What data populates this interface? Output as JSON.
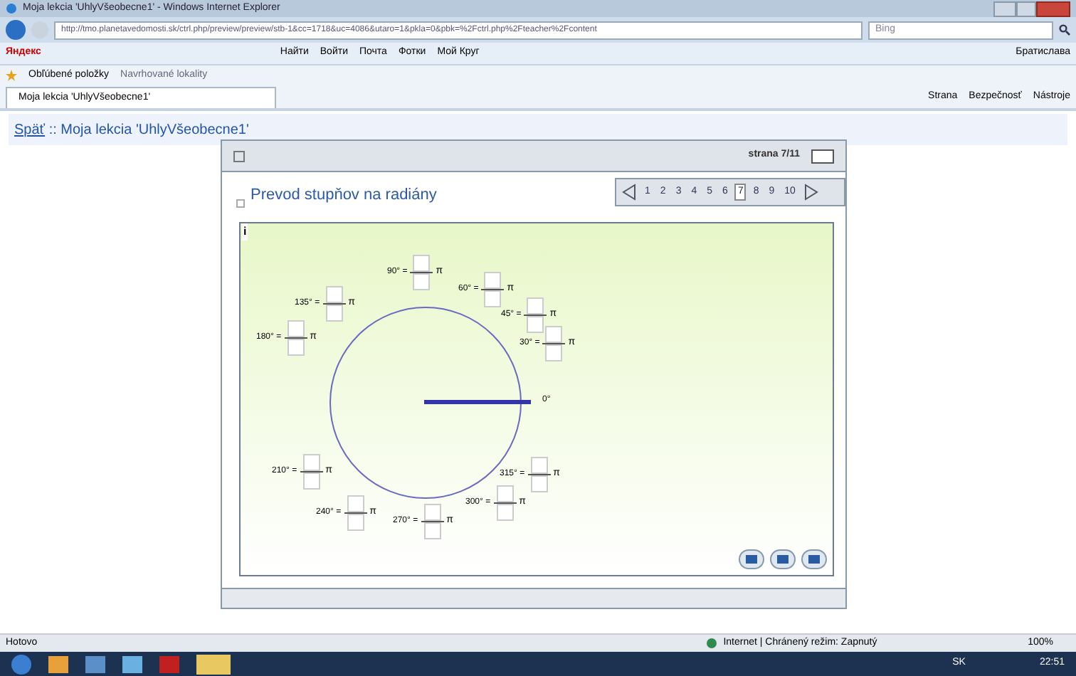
{
  "window": {
    "title": "Moja lekcia 'UhlyVšeobecne1' - Windows Internet Explorer"
  },
  "address_bar": {
    "url": "http://tmo.planetavedomosti.sk/ctrl.php/preview/preview/stb-1&cc=1718&uc=4086&utaro=1&pkla=0&pbk=%2Fctrl.php%2Fteacher%2Fcontent",
    "search_placeholder": "Bing"
  },
  "yandex_toolbar": {
    "logo": "Яндекс",
    "search_button": "Найти",
    "items": [
      "Войти",
      "Почта",
      "Фотки",
      "Мой Круг"
    ],
    "city": "Братислава"
  },
  "favorites_bar": {
    "favorites": "Obľúbené položky",
    "suggested": "Navrhované lokality"
  },
  "tabs": [
    {
      "label": "Moja lekcia 'UhlyVšeobecne1'",
      "selected": true
    }
  ],
  "command_bar": [
    "Strana",
    "Bezpečnosť",
    "Nástroje"
  ],
  "page": {
    "back_link": "Späť",
    "breadcrumb": " :: Moja lekcia 'UhlyVšeobecne1'",
    "lesson": {
      "page_indicator": "strana 7/11",
      "title": "Prevod stupňov na radiány",
      "info": "i",
      "pages": [
        {
          "label": "1",
          "selected": false
        },
        {
          "label": "2",
          "selected": false
        },
        {
          "label": "3",
          "selected": false
        },
        {
          "label": "4",
          "selected": false
        },
        {
          "label": "5",
          "selected": false
        },
        {
          "label": "6",
          "selected": false
        },
        {
          "label": "7",
          "selected": true
        },
        {
          "label": "8",
          "selected": false
        },
        {
          "label": "9",
          "selected": false
        },
        {
          "label": "10",
          "selected": false
        }
      ],
      "zero_label": "0°",
      "angles": [
        {
          "label": "90° =",
          "pi": "π"
        },
        {
          "label": "60° =",
          "pi": "π"
        },
        {
          "label": "135° =",
          "pi": "π"
        },
        {
          "label": "45° =",
          "pi": "π"
        },
        {
          "label": "180° =",
          "pi": "π"
        },
        {
          "label": "30° =",
          "pi": "π"
        },
        {
          "label": "210° =",
          "pi": "π"
        },
        {
          "label": "315° =",
          "pi": "π"
        },
        {
          "label": "240° =",
          "pi": "π"
        },
        {
          "label": "270° =",
          "pi": "π"
        },
        {
          "label": "300° =",
          "pi": "π"
        }
      ]
    }
  },
  "status_bar": {
    "text": "Hotovo",
    "zone": "Internet | Chránený režim: Zapnutý",
    "zoom": "100%"
  },
  "taskbar": {
    "language": "SK",
    "time": "22:51"
  }
}
